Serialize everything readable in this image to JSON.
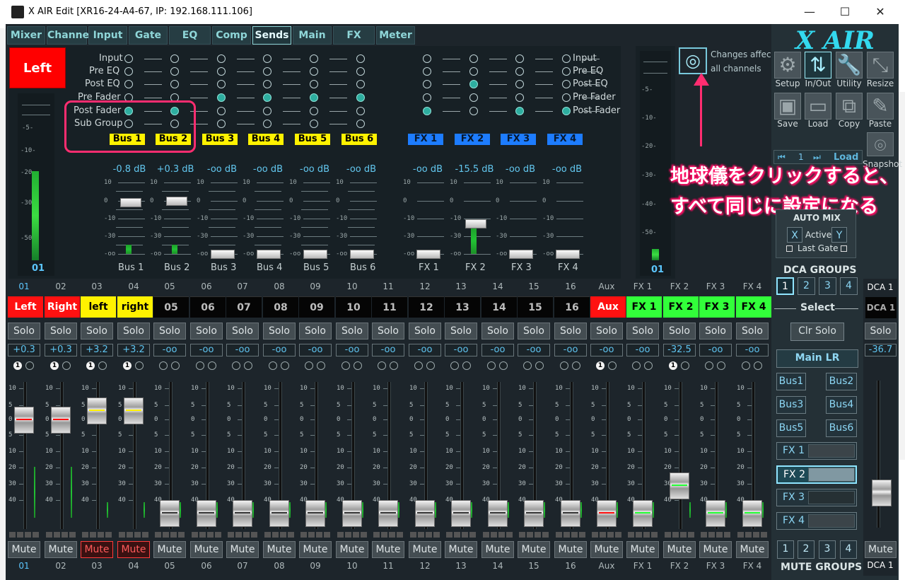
{
  "window": {
    "title": "X AIR Edit [XR16-24-A4-67, IP: 192.168.111.106]",
    "minimize": "—",
    "maximize": "☐",
    "close": "✕"
  },
  "tabs": [
    "Mixer",
    "Channel",
    "Input",
    "Gate",
    "EQ",
    "Comp",
    "Sends",
    "Main",
    "FX",
    "Meter"
  ],
  "channel_header": "Left",
  "meter_ticks": [
    "-5-",
    "-10-",
    "-20-",
    "-30-",
    "-50-",
    "01"
  ],
  "send_points": [
    "Input",
    "Pre EQ",
    "Post EQ",
    "Pre Fader",
    "Post Fader",
    "Sub Group"
  ],
  "fx_send_points": [
    "Input",
    "Pre EQ",
    "Post EQ",
    "Pre Fader",
    "Post Fader"
  ],
  "buses": [
    {
      "label": "Bus 1",
      "db": "-0.8 dB",
      "name": "Bus 1",
      "value": "-0.8"
    },
    {
      "label": "Bus 2",
      "db": "+0.3 dB",
      "name": "Bus 2",
      "value": "+0.3"
    },
    {
      "label": "Bus 3",
      "db": "-oo dB",
      "name": "Bus 3"
    },
    {
      "label": "Bus 4",
      "db": "-oo dB",
      "name": "Bus 4"
    },
    {
      "label": "Bus 5",
      "db": "-oo dB",
      "name": "Bus 5"
    },
    {
      "label": "Bus 6",
      "db": "-oo dB",
      "name": "Bus 6"
    }
  ],
  "fx_sends": [
    {
      "label": "FX 1",
      "db": "-oo dB",
      "name": "FX 1"
    },
    {
      "label": "FX 2",
      "db": "-15.5 dB",
      "name": "FX 2"
    },
    {
      "label": "FX 3",
      "db": "-oo dB",
      "name": "FX 3"
    },
    {
      "label": "FX 4",
      "db": "-oo dB",
      "name": "FX 4"
    }
  ],
  "send_scale": [
    "10",
    "0",
    "-10",
    "-30",
    "-oo"
  ],
  "right_meter_scale": [
    "-5-",
    "-10-",
    "-20-",
    "-30-",
    "-40-",
    "-50-",
    "01"
  ],
  "changes_affect": "Changes affect",
  "all_channels": "all channels",
  "annotation": {
    "line1": "地球儀をクリックすると、",
    "line2": "すべて同じに設定になる"
  },
  "sidebar": {
    "brand": "X AIR",
    "tools": [
      "Setup",
      "In/Out",
      "Utility",
      "Resize",
      "Save",
      "Load",
      "Copy",
      "Paste",
      "Snapshot"
    ],
    "snapshot_num": "1",
    "load": "Load",
    "automix": {
      "title": "AUTO MIX",
      "x": "X",
      "active": "Active",
      "y": "Y",
      "last_gate": "Last Gate"
    },
    "dca_groups": "DCA GROUPS",
    "dca_numbers": [
      "1",
      "2",
      "3",
      "4"
    ],
    "select": "Select",
    "clr_solo": "Clr Solo",
    "main_lr": "Main LR",
    "bus_buttons": [
      "Bus1",
      "Bus2",
      "Bus3",
      "Bus4",
      "Bus5",
      "Bus6"
    ],
    "fx_buttons": [
      "FX 1",
      "FX 2",
      "FX 3",
      "FX 4"
    ],
    "mute_groups": "MUTE GROUPS",
    "dca_label": "DCA 1",
    "dca_solo": "Solo",
    "dca_gain": "-36.7",
    "dca_mute": "Mute"
  },
  "channels": [
    {
      "num": "01",
      "name": "Left",
      "bg": "#ff1111",
      "fg": "#ffffff",
      "gain": "+0.3",
      "solo": "Solo",
      "mute": "Mute",
      "mute_on": false,
      "one": true,
      "fader": 0.58,
      "linecolor": "#ff1010"
    },
    {
      "num": "02",
      "name": "Right",
      "bg": "#ff1111",
      "fg": "#ffffff",
      "gain": "+0.3",
      "solo": "Solo",
      "mute": "Mute",
      "mute_on": false,
      "one": true,
      "fader": 0.58,
      "linecolor": "#ff1010"
    },
    {
      "num": "03",
      "name": "left",
      "bg": "#fff200",
      "fg": "#000000",
      "gain": "+3.2",
      "solo": "Solo",
      "mute": "Mute",
      "mute_on": true,
      "one": true,
      "fader": 0.69,
      "linecolor": "#fff200"
    },
    {
      "num": "04",
      "name": "right",
      "bg": "#fff200",
      "fg": "#000000",
      "gain": "+3.2",
      "solo": "Solo",
      "mute": "Mute",
      "mute_on": true,
      "one": true,
      "fader": 0.69,
      "linecolor": "#fff200"
    },
    {
      "num": "05",
      "name": "05",
      "bg": "#050505",
      "fg": "#bcbcbc",
      "gain": "-oo",
      "solo": "Solo",
      "mute": "Mute",
      "mute_on": false,
      "one": false,
      "fader": 0.05,
      "linecolor": "#333333"
    },
    {
      "num": "06",
      "name": "06",
      "bg": "#050505",
      "fg": "#bcbcbc",
      "gain": "-oo",
      "solo": "Solo",
      "mute": "Mute",
      "mute_on": false,
      "one": false,
      "fader": 0.05,
      "linecolor": "#333333"
    },
    {
      "num": "07",
      "name": "07",
      "bg": "#050505",
      "fg": "#bcbcbc",
      "gain": "-oo",
      "solo": "Solo",
      "mute": "Mute",
      "mute_on": false,
      "one": false,
      "fader": 0.05,
      "linecolor": "#333333"
    },
    {
      "num": "08",
      "name": "08",
      "bg": "#050505",
      "fg": "#bcbcbc",
      "gain": "-oo",
      "solo": "Solo",
      "mute": "Mute",
      "mute_on": false,
      "one": false,
      "fader": 0.05,
      "linecolor": "#333333"
    },
    {
      "num": "09",
      "name": "09",
      "bg": "#050505",
      "fg": "#bcbcbc",
      "gain": "-oo",
      "solo": "Solo",
      "mute": "Mute",
      "mute_on": false,
      "one": false,
      "fader": 0.05,
      "linecolor": "#333333"
    },
    {
      "num": "10",
      "name": "10",
      "bg": "#050505",
      "fg": "#bcbcbc",
      "gain": "-oo",
      "solo": "Solo",
      "mute": "Mute",
      "mute_on": false,
      "one": false,
      "fader": 0.05,
      "linecolor": "#333333"
    },
    {
      "num": "11",
      "name": "11",
      "bg": "#050505",
      "fg": "#bcbcbc",
      "gain": "-oo",
      "solo": "Solo",
      "mute": "Mute",
      "mute_on": false,
      "one": false,
      "fader": 0.05,
      "linecolor": "#333333"
    },
    {
      "num": "12",
      "name": "12",
      "bg": "#050505",
      "fg": "#bcbcbc",
      "gain": "-oo",
      "solo": "Solo",
      "mute": "Mute",
      "mute_on": false,
      "one": false,
      "fader": 0.05,
      "linecolor": "#333333"
    },
    {
      "num": "13",
      "name": "13",
      "bg": "#050505",
      "fg": "#bcbcbc",
      "gain": "-oo",
      "solo": "Solo",
      "mute": "Mute",
      "mute_on": false,
      "one": false,
      "fader": 0.05,
      "linecolor": "#333333"
    },
    {
      "num": "14",
      "name": "14",
      "bg": "#050505",
      "fg": "#bcbcbc",
      "gain": "-oo",
      "solo": "Solo",
      "mute": "Mute",
      "mute_on": false,
      "one": false,
      "fader": 0.05,
      "linecolor": "#333333"
    },
    {
      "num": "15",
      "name": "15",
      "bg": "#050505",
      "fg": "#bcbcbc",
      "gain": "-oo",
      "solo": "Solo",
      "mute": "Mute",
      "mute_on": false,
      "one": false,
      "fader": 0.05,
      "linecolor": "#333333"
    },
    {
      "num": "16",
      "name": "16",
      "bg": "#050505",
      "fg": "#bcbcbc",
      "gain": "-oo",
      "solo": "Solo",
      "mute": "Mute",
      "mute_on": false,
      "one": false,
      "fader": 0.05,
      "linecolor": "#333333"
    },
    {
      "num": "Aux",
      "name": "Aux",
      "bg": "#ff1111",
      "fg": "#ffffff",
      "gain": "-oo",
      "solo": "Solo",
      "mute": "Mute",
      "mute_on": false,
      "one": true,
      "fader": 0.05,
      "linecolor": "#ff1010"
    },
    {
      "num": "FX 1",
      "name": "FX 1",
      "bg": "#32ff3a",
      "fg": "#000000",
      "gain": "-oo",
      "solo": "Solo",
      "mute": "Mute",
      "mute_on": false,
      "one": false,
      "fader": 0.05,
      "linecolor": "#23ff34"
    },
    {
      "num": "FX 2",
      "name": "FX 2",
      "bg": "#32ff3a",
      "fg": "#000000",
      "gain": "-32.5",
      "solo": "Solo",
      "mute": "Mute",
      "mute_on": false,
      "one": true,
      "fader": 0.25,
      "linecolor": "#23ff34"
    },
    {
      "num": "FX 3",
      "name": "FX 3",
      "bg": "#32ff3a",
      "fg": "#000000",
      "gain": "-oo",
      "solo": "Solo",
      "mute": "Mute",
      "mute_on": false,
      "one": false,
      "fader": 0.05,
      "linecolor": "#23ff34"
    },
    {
      "num": "FX 4",
      "name": "FX 4",
      "bg": "#32ff3a",
      "fg": "#000000",
      "gain": "-oo",
      "solo": "Solo",
      "mute": "Mute",
      "mute_on": false,
      "one": false,
      "fader": 0.05,
      "linecolor": "#23ff34"
    }
  ],
  "channel_scale": [
    "10",
    "5",
    "0",
    "5",
    "10",
    "20",
    "30",
    "40",
    "50"
  ]
}
